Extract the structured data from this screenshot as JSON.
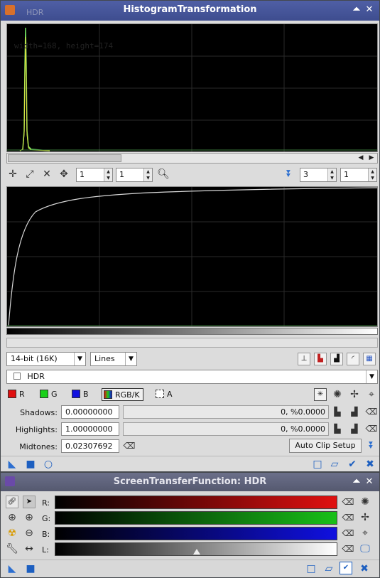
{
  "ht": {
    "title": "HistogramTransformation",
    "ghost_tab": "HDR",
    "overlay_text": "width=168, height=174",
    "zoom_h": "1",
    "zoom_v": "1",
    "channel_zoom": "3",
    "channel_zoom2": "1",
    "resolution": "14-bit (16K)",
    "graph_style": "Lines",
    "view": "HDR",
    "channels": [
      "R",
      "G",
      "B",
      "RGB/K",
      "A"
    ],
    "shadows_label": "Shadows:",
    "shadows_value": "0.00000000",
    "shadows_readout": "0, %0.0000",
    "highlights_label": "Highlights:",
    "highlights_value": "1.00000000",
    "highlights_readout": "0, %0.0000",
    "midtones_label": "Midtones:",
    "midtones_value": "0.02307692",
    "auto_clip": "Auto Clip Setup"
  },
  "stf": {
    "title": "ScreenTransferFunction: HDR",
    "r_label": "R:",
    "g_label": "G:",
    "b_label": "B:",
    "l_label": "L:"
  },
  "colors": {
    "accent": "#3e4d8f",
    "red": "#e01010",
    "green": "#18c018",
    "blue": "#1010e0"
  },
  "icons": [
    "pan-icon",
    "fit-icon",
    "zoom-fit-icon",
    "move-icon",
    "magnifier-icon",
    "chevrons-down-icon",
    "asterisk-icon",
    "new-instance-icon",
    "apply-icon",
    "reset-icon"
  ]
}
